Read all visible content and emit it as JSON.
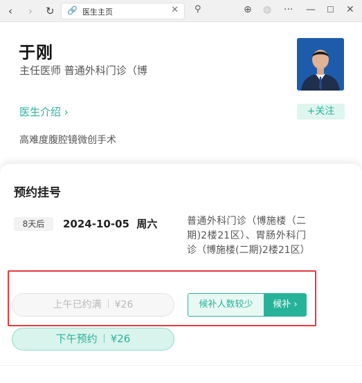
{
  "browser": {
    "tab_title": "医生主页",
    "icons": [
      "back-icon",
      "forward-icon",
      "reload-icon",
      "link-icon",
      "close-tab-icon",
      "search-icon",
      "download-icon",
      "globe-icon",
      "more-icon",
      "minimize-icon",
      "maximize-icon",
      "close-window-icon"
    ],
    "glyphs": {
      "back": "‹",
      "forward": "›",
      "reload": "↻",
      "link": "🔗",
      "close_tab": "✕",
      "search": "⚲",
      "download": "⊕",
      "globe": "◍",
      "more": "···",
      "minimize": "—",
      "maximize": "☐",
      "close": "✕"
    }
  },
  "doctor": {
    "name": "于刚",
    "title_line": "主任医师   普通外科门诊（博",
    "intro_link": "医生介绍",
    "intro_chevron": "›",
    "follow_button": "+关注",
    "specialty": "高难度腹腔镜微创手术"
  },
  "booking": {
    "heading": "预约挂号",
    "days_badge": "8天后",
    "date": "2024-10-05",
    "weekday": "周六",
    "department": "普通外科门诊（博施楼（二期)2楼21区）、胃肠外科门诊（博施楼(二期)2楼21区）",
    "morning": {
      "label": "上午已约满",
      "price": "¥26"
    },
    "waitlist": {
      "info": "候补人数较少",
      "button": "候补",
      "chevron": "›"
    },
    "afternoon": {
      "label": "下午预约",
      "price": "¥26"
    }
  },
  "colors": {
    "accent": "#27b39a",
    "highlight_border": "#e4393c"
  }
}
